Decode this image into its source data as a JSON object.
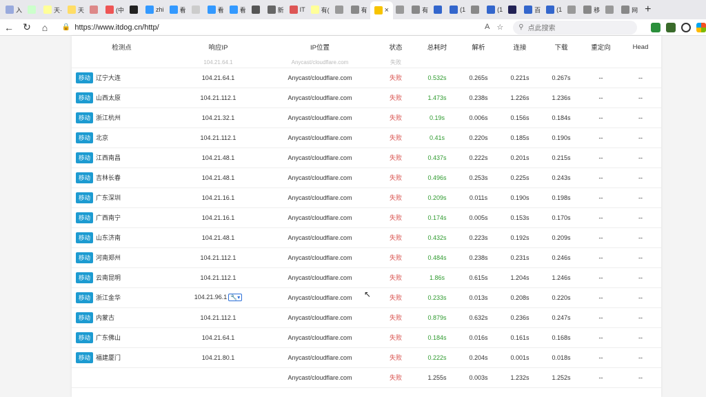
{
  "tabs": [
    {
      "label": "入 ",
      "color": "#9ad"
    },
    {
      "label": "",
      "color": "#cfc"
    },
    {
      "label": "天·",
      "color": "#ff9"
    },
    {
      "label": "天",
      "color": "#fd6"
    },
    {
      "label": "",
      "color": "#d88"
    },
    {
      "label": "(中",
      "color": "#e55"
    },
    {
      "label": "",
      "color": "#222"
    },
    {
      "label": "zhi",
      "color": "#39f"
    },
    {
      "label": "看",
      "color": "#39f"
    },
    {
      "label": "",
      "color": "#ccc"
    },
    {
      "label": "看",
      "color": "#39f"
    },
    {
      "label": "看",
      "color": "#39f"
    },
    {
      "label": "",
      "color": "#555"
    },
    {
      "label": "新",
      "color": "#666"
    },
    {
      "label": "IT",
      "color": "#d55"
    },
    {
      "label": "有(",
      "color": "#ff9"
    },
    {
      "label": "",
      "color": "#999"
    },
    {
      "label": "有",
      "color": "#888"
    },
    {
      "label": "",
      "color": "#999"
    },
    {
      "label": "有",
      "color": "#888"
    },
    {
      "label": "",
      "color": "#36c"
    },
    {
      "label": "(1",
      "color": "#36c"
    },
    {
      "label": "",
      "color": "#888"
    },
    {
      "label": "(1",
      "color": "#36c"
    },
    {
      "label": "",
      "color": "#225"
    },
    {
      "label": "百",
      "color": "#36c"
    },
    {
      "label": "(1",
      "color": "#36c"
    },
    {
      "label": "",
      "color": "#999"
    },
    {
      "label": "移",
      "color": "#888"
    },
    {
      "label": "",
      "color": "#999"
    },
    {
      "label": "网",
      "color": "#888"
    }
  ],
  "active_tab": {
    "label": "",
    "close": "×"
  },
  "new_tab": "+",
  "address": {
    "url": "https://www.itdog.cn/http/"
  },
  "search": {
    "placeholder": "点此搜索"
  },
  "table": {
    "headers": [
      "检测点",
      "响应IP",
      "IP位置",
      "状态",
      "总耗时",
      "解析",
      "连接",
      "下载",
      "重定向",
      "Head"
    ],
    "ghost_row": [
      "",
      "104.21.64.1",
      "Anycast/cloudflare.com",
      "失败",
      "",
      "",
      "",
      "",
      "",
      ""
    ],
    "rows": [
      {
        "isp": "移动",
        "loc": "辽宁大连",
        "ip": "104.21.64.1",
        "ipl": "Anycast/cloudflare.com",
        "status": "失败",
        "total": "0.532s",
        "dns": "0.265s",
        "conn": "0.221s",
        "dl": "0.267s",
        "redir": "--",
        "head": "--"
      },
      {
        "isp": "移动",
        "loc": "山西太原",
        "ip": "104.21.112.1",
        "ipl": "Anycast/cloudflare.com",
        "status": "失败",
        "total": "1.473s",
        "dns": "0.238s",
        "conn": "1.226s",
        "dl": "1.236s",
        "redir": "--",
        "head": "--"
      },
      {
        "isp": "移动",
        "loc": "浙江杭州",
        "ip": "104.21.32.1",
        "ipl": "Anycast/cloudflare.com",
        "status": "失败",
        "total": "0.19s",
        "dns": "0.006s",
        "conn": "0.156s",
        "dl": "0.184s",
        "redir": "--",
        "head": "--"
      },
      {
        "isp": "移动",
        "loc": "北京",
        "ip": "104.21.112.1",
        "ipl": "Anycast/cloudflare.com",
        "status": "失败",
        "total": "0.41s",
        "dns": "0.220s",
        "conn": "0.185s",
        "dl": "0.190s",
        "redir": "--",
        "head": "--"
      },
      {
        "isp": "移动",
        "loc": "江西南昌",
        "ip": "104.21.48.1",
        "ipl": "Anycast/cloudflare.com",
        "status": "失败",
        "total": "0.437s",
        "dns": "0.222s",
        "conn": "0.201s",
        "dl": "0.215s",
        "redir": "--",
        "head": "--"
      },
      {
        "isp": "移动",
        "loc": "吉林长春",
        "ip": "104.21.48.1",
        "ipl": "Anycast/cloudflare.com",
        "status": "失败",
        "total": "0.496s",
        "dns": "0.253s",
        "conn": "0.225s",
        "dl": "0.243s",
        "redir": "--",
        "head": "--"
      },
      {
        "isp": "移动",
        "loc": "广东深圳",
        "ip": "104.21.16.1",
        "ipl": "Anycast/cloudflare.com",
        "status": "失败",
        "total": "0.209s",
        "dns": "0.011s",
        "conn": "0.190s",
        "dl": "0.198s",
        "redir": "--",
        "head": "--"
      },
      {
        "isp": "移动",
        "loc": "广西南宁",
        "ip": "104.21.16.1",
        "ipl": "Anycast/cloudflare.com",
        "status": "失败",
        "total": "0.174s",
        "dns": "0.005s",
        "conn": "0.153s",
        "dl": "0.170s",
        "redir": "--",
        "head": "--"
      },
      {
        "isp": "移动",
        "loc": "山东济南",
        "ip": "104.21.48.1",
        "ipl": "Anycast/cloudflare.com",
        "status": "失败",
        "total": "0.432s",
        "dns": "0.223s",
        "conn": "0.192s",
        "dl": "0.209s",
        "redir": "--",
        "head": "--"
      },
      {
        "isp": "移动",
        "loc": "河南郑州",
        "ip": "104.21.112.1",
        "ipl": "Anycast/cloudflare.com",
        "status": "失败",
        "total": "0.484s",
        "dns": "0.238s",
        "conn": "0.231s",
        "dl": "0.246s",
        "redir": "--",
        "head": "--"
      },
      {
        "isp": "移动",
        "loc": "云南昆明",
        "ip": "104.21.112.1",
        "ipl": "Anycast/cloudflare.com",
        "status": "失败",
        "total": "1.86s",
        "dns": "0.615s",
        "conn": "1.204s",
        "dl": "1.246s",
        "redir": "--",
        "head": "--"
      },
      {
        "isp": "移动",
        "loc": "浙江金华",
        "ip": "104.21.96.1",
        "ipl": "Anycast/cloudflare.com",
        "status": "失败",
        "total": "0.233s",
        "dns": "0.013s",
        "conn": "0.208s",
        "dl": "0.220s",
        "redir": "--",
        "head": "--",
        "tool": true
      },
      {
        "isp": "移动",
        "loc": "内蒙古",
        "ip": "104.21.112.1",
        "ipl": "Anycast/cloudflare.com",
        "status": "失败",
        "total": "0.879s",
        "dns": "0.632s",
        "conn": "0.236s",
        "dl": "0.247s",
        "redir": "--",
        "head": "--"
      },
      {
        "isp": "移动",
        "loc": "广东佛山",
        "ip": "104.21.64.1",
        "ipl": "Anycast/cloudflare.com",
        "status": "失败",
        "total": "0.184s",
        "dns": "0.016s",
        "conn": "0.161s",
        "dl": "0.168s",
        "redir": "--",
        "head": "--"
      },
      {
        "isp": "移动",
        "loc": "福建厦门",
        "ip": "104.21.80.1",
        "ipl": "Anycast/cloudflare.com",
        "status": "失败",
        "total": "0.222s",
        "dns": "0.204s",
        "conn": "0.001s",
        "dl": "0.018s",
        "redir": "--",
        "head": "--"
      },
      {
        "isp": "",
        "loc": "",
        "ip": "",
        "ipl": "Anycast/cloudflare.com",
        "status": "失败",
        "total": "1.255s",
        "dns": "0.003s",
        "conn": "1.232s",
        "dl": "1.252s",
        "redir": "--",
        "head": "--"
      }
    ]
  }
}
